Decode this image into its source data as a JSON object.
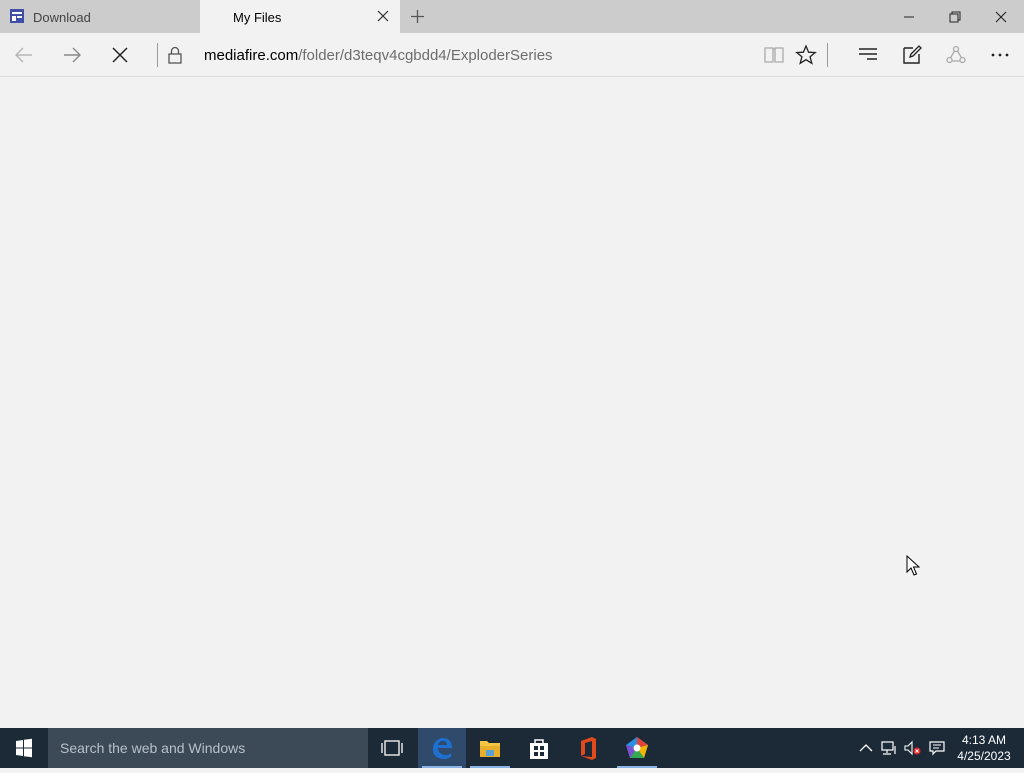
{
  "tabs": [
    {
      "label": "Download",
      "active": false
    },
    {
      "label": "My Files",
      "active": true
    }
  ],
  "address": {
    "host": "mediafire.com",
    "path": "/folder/d3teqv4cgbdd4/ExploderSeries"
  },
  "taskbar": {
    "search_placeholder": "Search the web and Windows",
    "time": "4:13 AM",
    "date": "4/25/2023"
  },
  "icons": {
    "tab_close": "close-icon",
    "new_tab": "plus-icon",
    "back": "arrow-left-icon",
    "forward": "arrow-right-icon",
    "stop": "stop-icon",
    "lock": "lock-icon",
    "reading_view": "book-icon",
    "favorite": "star-icon",
    "hub": "hub-icon",
    "web_note": "pen-note-icon",
    "share": "share-icon",
    "more": "ellipsis-icon"
  },
  "colors": {
    "tab_strip": "#cccccc",
    "page_background": "#f2f2f2",
    "taskbar": "#1c2a38",
    "edge_blue": "#1e6fd0",
    "office_orange": "#e2491b"
  }
}
